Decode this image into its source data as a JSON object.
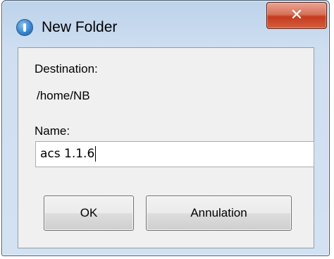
{
  "window": {
    "title": "New Folder",
    "close_symbol": "✕",
    "icon": "info-app-icon"
  },
  "form": {
    "destination_label": "Destination:",
    "destination_value": "/home/NB",
    "name_label": "Name:",
    "name_value": "acs 1.1.6"
  },
  "buttons": {
    "ok_label": "OK",
    "cancel_label": "Annulation"
  },
  "colors": {
    "frame": "#c6d9ee",
    "close_button": "#c43b1f",
    "content_bg": "#f0f0f0"
  }
}
